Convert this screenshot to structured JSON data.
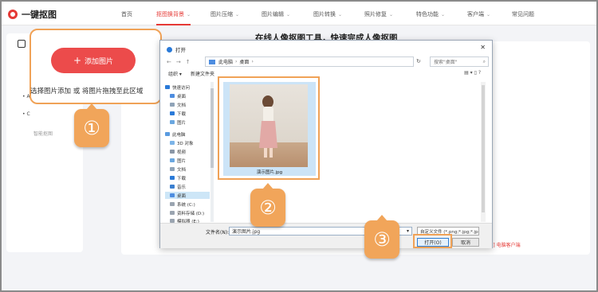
{
  "app": {
    "name": "一键抠图"
  },
  "nav": {
    "items": [
      {
        "label": "首页",
        "has_menu": false
      },
      {
        "label": "抠图换背景",
        "has_menu": true,
        "active": true
      },
      {
        "label": "图片压缩",
        "has_menu": true
      },
      {
        "label": "图片编辑",
        "has_menu": true
      },
      {
        "label": "图片转换",
        "has_menu": true
      },
      {
        "label": "照片修复",
        "has_menu": true
      },
      {
        "label": "特色功能",
        "has_menu": true
      },
      {
        "label": "客户端",
        "has_menu": true
      },
      {
        "label": "常见问题",
        "has_menu": false
      }
    ]
  },
  "sidebar": {
    "bullets": [
      "•  A",
      "•  C"
    ],
    "hint": "智能抠图"
  },
  "main": {
    "title": "在线人像抠图工具，快速完成人像抠图",
    "footer_text": "[帮助] 电脑客户端"
  },
  "upload": {
    "add_button": "添加图片",
    "drop_hint": "选择图片添加 或 将图片拖拽至此区域"
  },
  "markers": [
    "①",
    "②",
    "③"
  ],
  "dialog": {
    "title": "打开",
    "breadcrumb": [
      "此电脑",
      "桌面"
    ],
    "search_placeholder": "搜索\"桌面\"",
    "organize": "组织 ▾",
    "new_folder": "新建文件夹",
    "tree": [
      {
        "label": "快速访问",
        "color": "#2a7ad8"
      },
      {
        "label": "桌面",
        "color": "#4d8de0"
      },
      {
        "label": "文档",
        "color": "#8fa3b8"
      },
      {
        "label": "下载",
        "color": "#2a7ad8"
      },
      {
        "label": "图片",
        "color": "#6aa7e0"
      },
      {
        "label": "此电脑",
        "color": "#5a9be0"
      },
      {
        "label": "3D 对象",
        "color": "#7cb4e8"
      },
      {
        "label": "视频",
        "color": "#8a96a6"
      },
      {
        "label": "图片",
        "color": "#6aa7e0"
      },
      {
        "label": "文档",
        "color": "#8fa3b8"
      },
      {
        "label": "下载",
        "color": "#2a7ad8"
      },
      {
        "label": "音乐",
        "color": "#3a7fd0"
      },
      {
        "label": "桌面",
        "color": "#4d8de0",
        "selected": true
      },
      {
        "label": "系统 (C:)",
        "color": "#9aa4b0"
      },
      {
        "label": "资料存储 (D:)",
        "color": "#9aa4b0"
      },
      {
        "label": "模拟器 (E:)",
        "color": "#9aa4b0"
      }
    ],
    "file_name": "演示图片.jpg",
    "file_name_label": "文件名(N):",
    "file_name_value": "演示图片.jpg",
    "file_type": "自定义文件 (*.png;*.jpg;*.jpeg",
    "open_button": "打开(O)",
    "cancel_button": "取消"
  }
}
